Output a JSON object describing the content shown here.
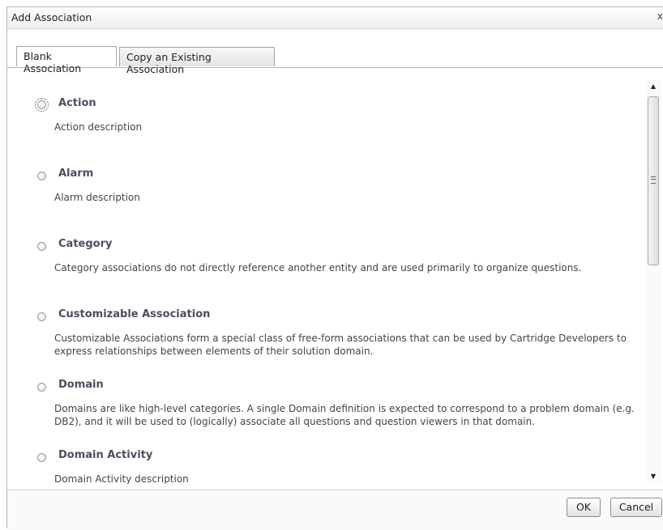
{
  "dialog": {
    "title": "Add Association",
    "close_label": "x"
  },
  "tabs": [
    {
      "label": "Blank Association",
      "active": true
    },
    {
      "label": "Copy an Existing Association",
      "active": false
    }
  ],
  "associations": [
    {
      "label": "Action",
      "description": "Action description"
    },
    {
      "label": "Alarm",
      "description": "Alarm description"
    },
    {
      "label": "Category",
      "description": "Category associations do not directly reference another entity and are used primarily to organize questions."
    },
    {
      "label": "Customizable Association",
      "description": "Customizable Associations form a special class of free-form associations that can be used by Cartridge Developers to express relationships between elements of their solution domain."
    },
    {
      "label": "Domain",
      "description": "Domains are like high-level categories. A single Domain definition is expected to correspond to a problem domain (e.g. DB2), and it will be used to (logically) associate all questions and question viewers in that domain."
    },
    {
      "label": "Domain Activity",
      "description": "Domain Activity description"
    }
  ],
  "scrollbar": {
    "up_icon": "arrow-up",
    "down_icon": "arrow-down"
  },
  "buttons": {
    "ok": "OK",
    "cancel": "Cancel"
  }
}
